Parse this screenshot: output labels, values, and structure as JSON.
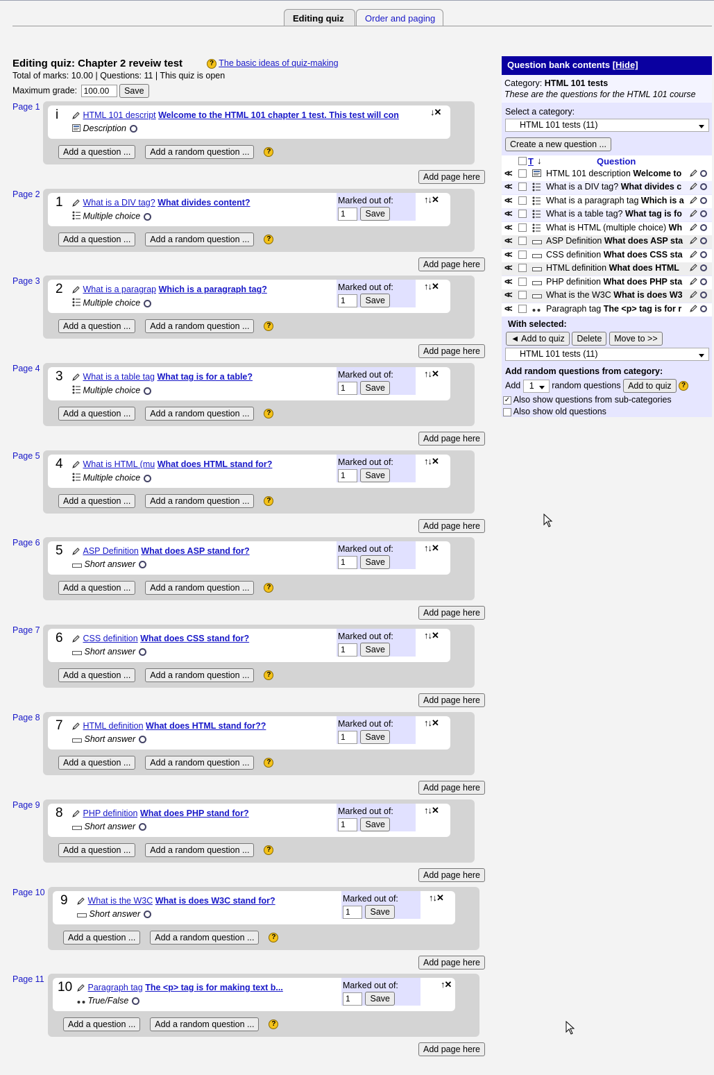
{
  "tabs": [
    "Editing quiz",
    "Order and paging"
  ],
  "heading": "Editing quiz: Chapter 2 reveiw test",
  "help_link": "The basic ideas of quiz-making",
  "totals": "Total of marks: 10.00 | Questions: 11 | This quiz is open",
  "max_grade_label": "Maximum grade:",
  "max_grade_value": "100.00",
  "save_label": "Save",
  "add_question_label": "Add a question ...",
  "add_random_label": "Add a random question ...",
  "add_page_label": "Add page here",
  "marked_label": "Marked out of:",
  "pages": [
    {
      "page": "Page 1",
      "num": "i",
      "name": "HTML 101 descript",
      "text": "Welcome to the HTML 101 chapter 1 test. This test will con",
      "type": "Description",
      "mark": "",
      "arrows": "↓✕"
    },
    {
      "page": "Page 2",
      "num": "1",
      "name": "What is a DIV tag?",
      "text": "What divides content?",
      "type": "Multiple choice",
      "mark": "1",
      "arrows": "↑↓✕"
    },
    {
      "page": "Page 3",
      "num": "2",
      "name": "What is a paragrap",
      "text": "Which is a paragraph tag?",
      "type": "Multiple choice",
      "mark": "1",
      "arrows": "↑↓✕"
    },
    {
      "page": "Page 4",
      "num": "3",
      "name": "What is a table tag",
      "text": "What tag is for a table?",
      "type": "Multiple choice",
      "mark": "1",
      "arrows": "↑↓✕"
    },
    {
      "page": "Page 5",
      "num": "4",
      "name": "What is HTML (mu",
      "text": "What does HTML stand for?",
      "type": "Multiple choice",
      "mark": "1",
      "arrows": "↑↓✕"
    },
    {
      "page": "Page 6",
      "num": "5",
      "name": "ASP Definition",
      "text": "What does ASP stand for?",
      "type": "Short answer",
      "mark": "1",
      "arrows": "↑↓✕"
    },
    {
      "page": "Page 7",
      "num": "6",
      "name": "CSS definition",
      "text": "What does CSS stand for?",
      "type": "Short answer",
      "mark": "1",
      "arrows": "↑↓✕"
    },
    {
      "page": "Page 8",
      "num": "7",
      "name": "HTML definition",
      "text": "What does HTML stand for??",
      "type": "Short answer",
      "mark": "1",
      "arrows": "↑↓✕"
    },
    {
      "page": "Page 9",
      "num": "8",
      "name": "PHP definition",
      "text": "What does PHP stand for?",
      "type": "Short answer",
      "mark": "1",
      "arrows": "↑↓✕"
    },
    {
      "page": "Page 10",
      "num": "9",
      "name": "What is the W3C",
      "text": "What is does W3C stand for?",
      "type": "Short answer",
      "mark": "1",
      "arrows": "↑↓✕"
    },
    {
      "page": "Page 11",
      "num": "10",
      "name": "Paragraph tag",
      "text": "The <p> tag is for making text b...",
      "type": "True/False",
      "mark": "1",
      "arrows": "↑✕"
    }
  ],
  "bank": {
    "title": "Question bank contents",
    "hide": "[Hide]",
    "category_label": "Category:",
    "category_name": "HTML 101 tests",
    "category_desc": "These are the questions for the HTML 101 course",
    "select_label": "Select a category:",
    "select_value": "HTML 101 tests (11)",
    "create_label": "Create a new question ...",
    "col_type": "T",
    "col_question": "Question",
    "questions": [
      {
        "name": "HTML 101 description",
        "text": "Welcome to",
        "type": "description"
      },
      {
        "name": "What is a DIV tag?",
        "text": "What divides c",
        "type": "multichoice"
      },
      {
        "name": "What is a paragraph tag",
        "text": "Which is a",
        "type": "multichoice"
      },
      {
        "name": "What is a table tag?",
        "text": "What tag is fo",
        "type": "multichoice"
      },
      {
        "name": "What is HTML (multiple choice)",
        "text": "Wh",
        "type": "multichoice"
      },
      {
        "name": "ASP Definition",
        "text": "What does ASP sta",
        "type": "shortanswer"
      },
      {
        "name": "CSS definition",
        "text": "What does CSS sta",
        "type": "shortanswer"
      },
      {
        "name": "HTML definition",
        "text": "What does HTML",
        "type": "shortanswer"
      },
      {
        "name": "PHP definition",
        "text": "What does PHP sta",
        "type": "shortanswer"
      },
      {
        "name": "What is the W3C",
        "text": "What is does W3",
        "type": "shortanswer"
      },
      {
        "name": "Paragraph tag",
        "text": "The <p> tag is for r",
        "type": "truefalse"
      }
    ],
    "with_selected": "With selected:",
    "add_to_quiz": "◄ Add to quiz",
    "delete": "Delete",
    "move_to": "Move to >>",
    "move_select": "HTML 101 tests (11)",
    "random_heading": "Add random questions from category:",
    "add_word": "Add",
    "random_count": "1",
    "random_word": "random questions",
    "add_to_quiz2": "Add to quiz",
    "also_sub": "Also show questions from sub-categories",
    "also_old": "Also show old questions"
  }
}
